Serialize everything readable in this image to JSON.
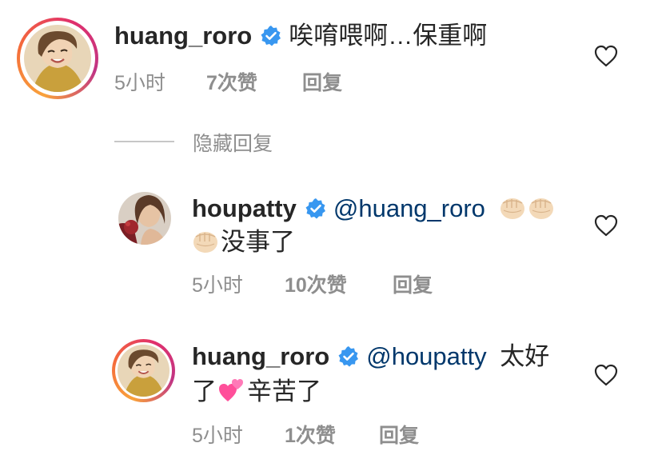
{
  "comments": [
    {
      "username": "huang_roro",
      "mention": "",
      "text_line1": "唉唷喂啊…保重啊",
      "text_line2": "",
      "time": "5小时",
      "likes": "7次赞",
      "reply": "回复",
      "avatar_icon": "avatar-huang-roro"
    },
    {
      "username": "houpatty",
      "mention": "@huang_roro",
      "text_line1": "",
      "text_line2": "没事了",
      "emoji_line1": [
        "fist-emoji",
        "fist-emoji"
      ],
      "emoji_line2": [
        "fist-emoji"
      ],
      "time": "5小时",
      "likes": "10次赞",
      "reply": "回复",
      "avatar_icon": "avatar-houpatty"
    },
    {
      "username": "huang_roro",
      "mention": "@houpatty",
      "text_line1": "太好",
      "text_line2_a": "了",
      "text_line2_b": "辛苦了",
      "emoji_line2": [
        "two-hearts-emoji"
      ],
      "time": "5小时",
      "likes": "1次赞",
      "reply": "回复",
      "avatar_icon": "avatar-huang-roro"
    }
  ],
  "hide_replies": "隐藏回复",
  "colors": {
    "mention": "#00376b",
    "muted": "#8e8e8e",
    "verified": "#3897f0",
    "text": "#262626"
  }
}
